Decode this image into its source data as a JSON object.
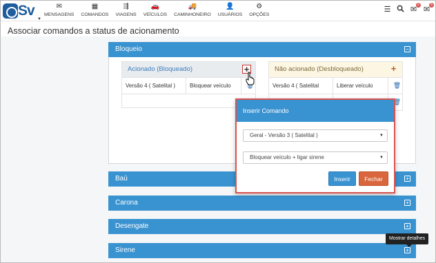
{
  "app": {
    "logo_text": "Sv"
  },
  "nav": {
    "items": [
      {
        "label": "MENSAGENS",
        "icon": "envelope-icon",
        "glyph": "✉"
      },
      {
        "label": "COMANDOS",
        "icon": "grid-icon",
        "glyph": "▦"
      },
      {
        "label": "VIAGENS",
        "icon": "route-icon",
        "glyph": "⇶"
      },
      {
        "label": "VEÍCULOS",
        "icon": "car-icon",
        "glyph": "🚗"
      },
      {
        "label": "CAMINHONEIRO",
        "icon": "truck-icon",
        "glyph": "🚚"
      },
      {
        "label": "USUÁRIOS",
        "icon": "user-icon",
        "glyph": "👤"
      },
      {
        "label": "OPÇÕES",
        "icon": "gears-icon",
        "glyph": "⚙"
      }
    ]
  },
  "toolbar": {
    "list_icon": "☰",
    "search_icon": "🔍",
    "messages_badge": "2",
    "alerts_badge": "5"
  },
  "page": {
    "title": "Associar comandos a status de acionamento"
  },
  "panels": {
    "bloqueio": {
      "title": "Bloqueio",
      "toggle": "−"
    },
    "bau": {
      "title": "Baú",
      "toggle": "+"
    },
    "carona": {
      "title": "Carona",
      "toggle": "+"
    },
    "desengate": {
      "title": "Desengate",
      "toggle": "+"
    },
    "sirene": {
      "title": "Sirene",
      "toggle": "+"
    }
  },
  "acionado": {
    "title": "Acionado (Bloqueado)",
    "rows": [
      {
        "version": "Versão 4 ( Satelital )",
        "command": "Bloquear veículo"
      }
    ]
  },
  "nao_acionado": {
    "title": "Não acionado (Desbloqueado)",
    "rows": [
      {
        "version": "Versão 4 ( Satelital",
        "command": "Liberar veículo"
      }
    ]
  },
  "modal": {
    "title": "Inserir Comando",
    "version_select": "Geral - Versão 3 ( Satelital )",
    "command_select": "Bloquear veículo + ligar sirene",
    "insert_label": "Inserir",
    "close_label": "Fechar"
  },
  "tooltip": {
    "text": "Mostrar detalhes"
  },
  "colors": {
    "primary": "#3a93d1",
    "danger": "#d9663c",
    "accent_red": "#c9302c",
    "brand": "#1f5d9e"
  }
}
